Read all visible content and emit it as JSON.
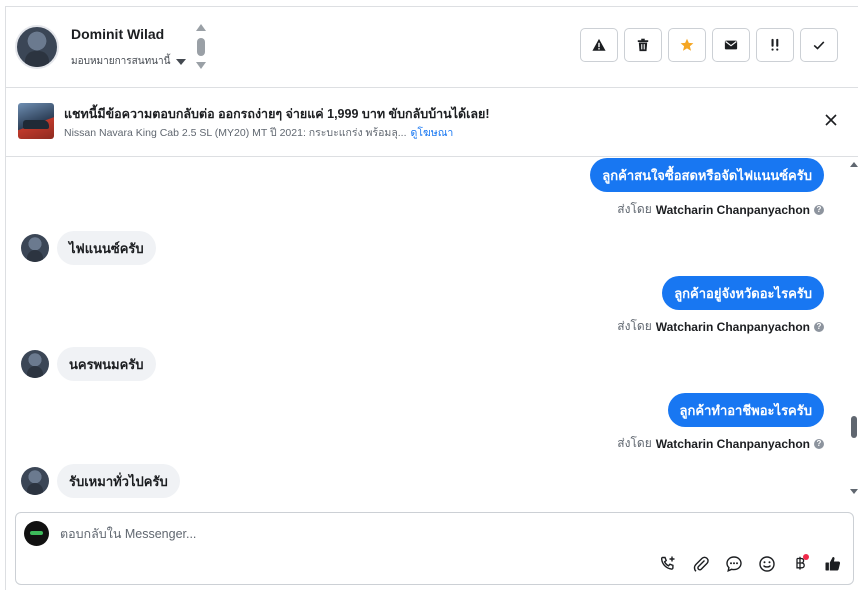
{
  "header": {
    "contact_name": "Dominit Wilad",
    "assign_label": "มอบหมายการสนทนานี้",
    "actions": [
      {
        "name": "spam-icon",
        "label": "Spam"
      },
      {
        "name": "trash-icon",
        "label": "Delete"
      },
      {
        "name": "star-icon",
        "label": "Star",
        "color": "#f5a623"
      },
      {
        "name": "envelope-icon",
        "label": "Mark unread"
      },
      {
        "name": "follow-up-icon",
        "label": "Follow up"
      },
      {
        "name": "check-icon",
        "label": "Done"
      }
    ]
  },
  "ad": {
    "title": "แชทนี้มีข้อความตอบกลับต่อ ออกรถง่ายๆ จ่ายแค่ 1,999 บาท ขับกลับบ้านได้เลย!",
    "subtitle": "Nissan Navara King Cab 2.5 SL (MY20) MT ปี 2021: กระบะแกร่ง พร้อมลุ...",
    "link": "ดูโฆษณา"
  },
  "messages": [
    {
      "dir": "out",
      "text": "ลูกค้าสนใจซื้อสดหรือจัดไฟแนนซ์ครับ",
      "sent_prefix": "ส่งโดย",
      "sender": "Watcharin Chanpanyachon"
    },
    {
      "dir": "in",
      "text": "ไฟแนนซ์ครับ"
    },
    {
      "dir": "out",
      "text": "ลูกค้าอยู่จังหวัดอะไรครับ",
      "sent_prefix": "ส่งโดย",
      "sender": "Watcharin Chanpanyachon"
    },
    {
      "dir": "in",
      "text": "นครพนมครับ"
    },
    {
      "dir": "out",
      "text": "ลูกค้าทำอาชีพอะไรครับ",
      "sent_prefix": "ส่งโดย",
      "sender": "Watcharin Chanpanyachon"
    },
    {
      "dir": "in",
      "text": "รับเหมาทั่วไปครับ"
    }
  ],
  "composer": {
    "placeholder": "ตอบกลับใน Messenger...",
    "tools": [
      "call-add-icon",
      "paperclip-icon",
      "saved-reply-icon",
      "emoji-icon",
      "payment-baht-icon",
      "thumbs-up-icon"
    ]
  },
  "colors": {
    "accent": "#1877f2",
    "incoming_bubble": "#f0f2f5",
    "star": "#f5a623",
    "notification_dot": "#f02849"
  }
}
